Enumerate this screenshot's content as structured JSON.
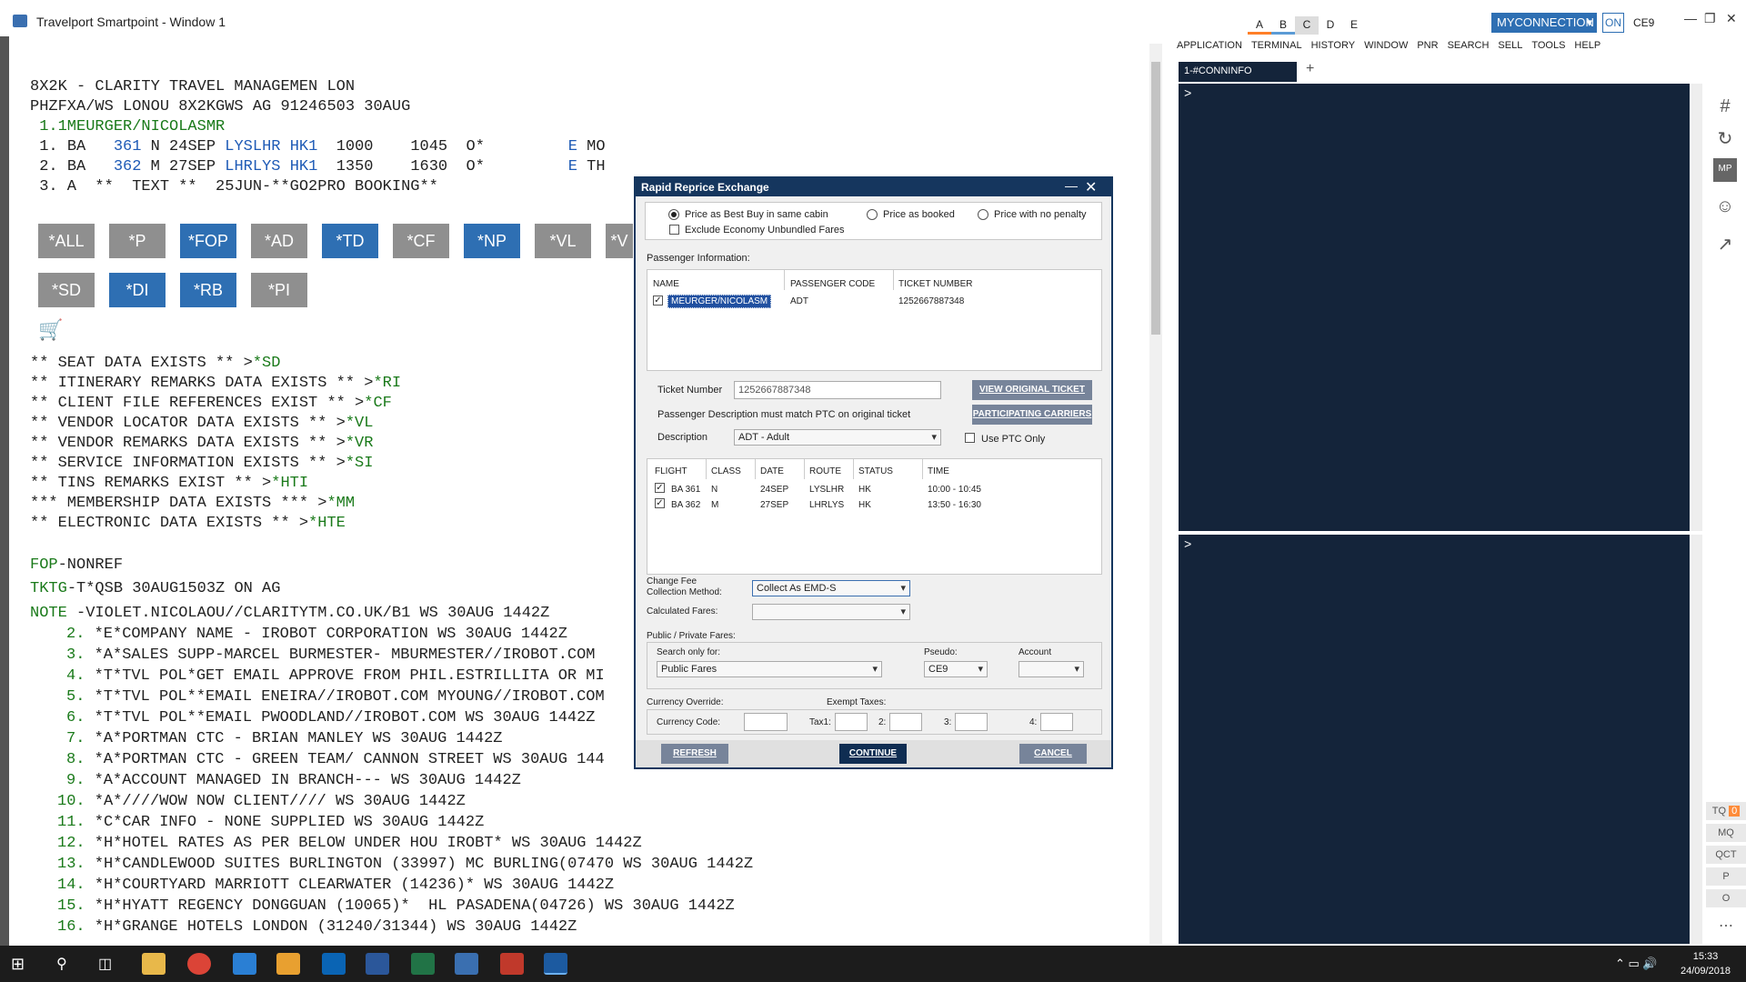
{
  "window": {
    "title": "Travelport Smartpoint - Window 1",
    "tabs": [
      "A",
      "B",
      "C",
      "D",
      "E"
    ],
    "connection": "MYCONNECTION",
    "on_label": "ON",
    "pcc": "CE9",
    "controls": [
      "—",
      "❐",
      "✕"
    ]
  },
  "terminal_left": {
    "header_lines": [
      "8X2K - CLARITY TRAVEL MANAGEMEN LON",
      "PHZFXA/WS LONOU 8X2KGWS AG 91246503 30AUG"
    ],
    "passenger_line": " 1.1MEURGER/NICOLASMR",
    "segments": [
      {
        "num": " 1.",
        "carrier": "BA",
        "flight": "361",
        "rest1": "N 24SEP",
        "route": "LYSLHR",
        "status": "HK1",
        "times": "1000    1045  O*",
        "flag": "E",
        "day": "MO"
      },
      {
        "num": " 2.",
        "carrier": "BA",
        "flight": "362",
        "rest1": "M 27SEP",
        "route": "LHRLYS",
        "status": "HK1",
        "times": "1350    1630  O*",
        "flag": "E",
        "day": "TH"
      }
    ],
    "seg3": " 3. A  **  TEXT **  25JUN-**GO2PRO BOOKING**",
    "buttons_row1": [
      "*ALL",
      "*P",
      "*FOP",
      "*AD",
      "*TD",
      "*CF",
      "*NP",
      "*VL",
      "*V"
    ],
    "buttons_row2": [
      "*SD",
      "*DI",
      "*RB",
      "*PI"
    ],
    "data_lines": [
      {
        "text": "** SEAT DATA EXISTS ** >",
        "link": "*SD"
      },
      {
        "text": "** ITINERARY REMARKS DATA EXISTS ** >",
        "link": "*RI"
      },
      {
        "text": "** CLIENT FILE REFERENCES EXIST ** >",
        "link": "*CF"
      },
      {
        "text": "** VENDOR LOCATOR DATA EXISTS ** >",
        "link": "*VL"
      },
      {
        "text": "** VENDOR REMARKS DATA EXISTS ** >",
        "link": "*VR"
      },
      {
        "text": "** SERVICE INFORMATION EXISTS ** >",
        "link": "*SI"
      },
      {
        "text": "** TINS REMARKS EXIST ** >",
        "link": "*HTI"
      },
      {
        "text": "*** MEMBERSHIP DATA EXISTS *** >",
        "link": "*MM"
      },
      {
        "text": "** ELECTRONIC DATA EXISTS ** >",
        "link": "*HTE"
      }
    ],
    "fop_label": "FOP",
    "fop_value": "-NONREF",
    "tktg_label": "TKTG",
    "tktg_value": "-T*QSB 30AUG1503Z ON AG",
    "note_label": "NOTE",
    "note_value": " -VIOLET.NICOLAOU//CLARITYTM.CO.UK/B1 WS 30AUG 1442Z",
    "notes": [
      {
        "n": "2.",
        "t": "*E*COMPANY NAME - IROBOT CORPORATION WS 30AUG 1442Z"
      },
      {
        "n": "3.",
        "t": "*A*SALES SUPP-MARCEL BURMESTER- MBURMESTER//IROBOT.COM"
      },
      {
        "n": "4.",
        "t": "*T*TVL POL*GET EMAIL APPROVE FROM PHIL.ESTRILLITA OR MI"
      },
      {
        "n": "5.",
        "t": "*T*TVL POL**EMAIL ENEIRA//IROBOT.COM MYOUNG//IROBOT.COM"
      },
      {
        "n": "6.",
        "t": "*T*TVL POL**EMAIL PWOODLAND//IROBOT.COM WS 30AUG 1442Z"
      },
      {
        "n": "7.",
        "t": "*A*PORTMAN CTC - BRIAN MANLEY WS 30AUG 1442Z"
      },
      {
        "n": "8.",
        "t": "*A*PORTMAN CTC - GREEN TEAM/ CANNON STREET WS 30AUG 144"
      },
      {
        "n": "9.",
        "t": "*A*ACCOUNT MANAGED IN BRANCH--- WS 30AUG 1442Z"
      },
      {
        "n": "10.",
        "t": "*A*////WOW NOW CLIENT//// WS 30AUG 1442Z"
      },
      {
        "n": "11.",
        "t": "*C*CAR INFO - NONE SUPPLIED WS 30AUG 1442Z"
      },
      {
        "n": "12.",
        "t": "*H*HOTEL RATES AS PER BELOW UNDER HOU IROBT* WS 30AUG 1442Z"
      },
      {
        "n": "13.",
        "t": "*H*CANDLEWOOD SUITES BURLINGTON (33997) MC BURLING(07470 WS 30AUG 1442Z"
      },
      {
        "n": "14.",
        "t": "*H*COURTYARD MARRIOTT CLEARWATER (14236)* WS 30AUG 1442Z"
      },
      {
        "n": "15.",
        "t": "*H*HYATT REGENCY DONGGUAN (10065)*  HL PASADENA(04726) WS 30AUG 1442Z"
      },
      {
        "n": "16.",
        "t": "*H*GRANGE HOTELS LONDON (31240/31344) WS 30AUG 1442Z"
      }
    ]
  },
  "right_panel": {
    "menu": [
      "APPLICATION",
      "TERMINAL",
      "HISTORY",
      "WINDOW",
      "PNR",
      "SEARCH",
      "SELL",
      "TOOLS",
      "HELP"
    ],
    "tab_label": "1-#CONNINFO",
    "prompt": ">",
    "tools": [
      "TQ",
      "MQ",
      "QCT",
      "P",
      "O"
    ],
    "tq_count": "0"
  },
  "dialog": {
    "title": "Rapid Reprice Exchange",
    "radios": [
      "Price as Best Buy in same cabin",
      "Price as booked",
      "Price with no penalty"
    ],
    "exclude_label": "Exclude Economy Unbundled Fares",
    "pax_info_label": "Passenger Information:",
    "pax_headers": [
      "NAME",
      "PASSENGER CODE",
      "TICKET NUMBER"
    ],
    "pax_row": {
      "name": "MEURGER/NICOLASM",
      "code": "ADT",
      "ticket": "1252667887348"
    },
    "ticket_number_label": "Ticket Number",
    "ticket_number_value": "1252667887348",
    "view_original_btn": "VIEW ORIGINAL TICKET",
    "participating_btn": "PARTICIPATING CARRIERS",
    "pax_desc_note": "Passenger Description must match PTC on original ticket",
    "description_label": "Description",
    "description_value": "ADT - Adult",
    "use_ptc_label": "Use PTC Only",
    "flight_headers": [
      "FLIGHT",
      "CLASS",
      "DATE",
      "ROUTE",
      "STATUS",
      "TIME"
    ],
    "flights": [
      {
        "flight": "BA 361",
        "class": "N",
        "date": "24SEP",
        "route": "LYSLHR",
        "status": "HK",
        "time": "10:00 - 10:45"
      },
      {
        "flight": "BA 362",
        "class": "M",
        "date": "27SEP",
        "route": "LHRLYS",
        "status": "HK",
        "time": "13:50 - 16:30"
      }
    ],
    "change_fee_label_1": "Change Fee",
    "change_fee_label_2": "Collection Method:",
    "change_fee_value": "Collect As EMD-S",
    "calculated_fares_label": "Calculated Fares:",
    "public_private_label": "Public / Private Fares:",
    "search_only_label": "Search only for:",
    "search_only_value": "Public Fares",
    "pseudo_label": "Pseudo:",
    "pseudo_value": "CE9",
    "account_label": "Account",
    "currency_override_label": "Currency Override:",
    "exempt_taxes_label": "Exempt Taxes:",
    "currency_code_label": "Currency Code:",
    "tax_labels": [
      "Tax1:",
      "2:",
      "3:",
      "4:"
    ],
    "refresh_btn": "REFRESH",
    "continue_btn": "CONTINUE",
    "cancel_btn": "CANCEL"
  },
  "taskbar": {
    "time": "15:33",
    "date": "24/09/2018"
  }
}
